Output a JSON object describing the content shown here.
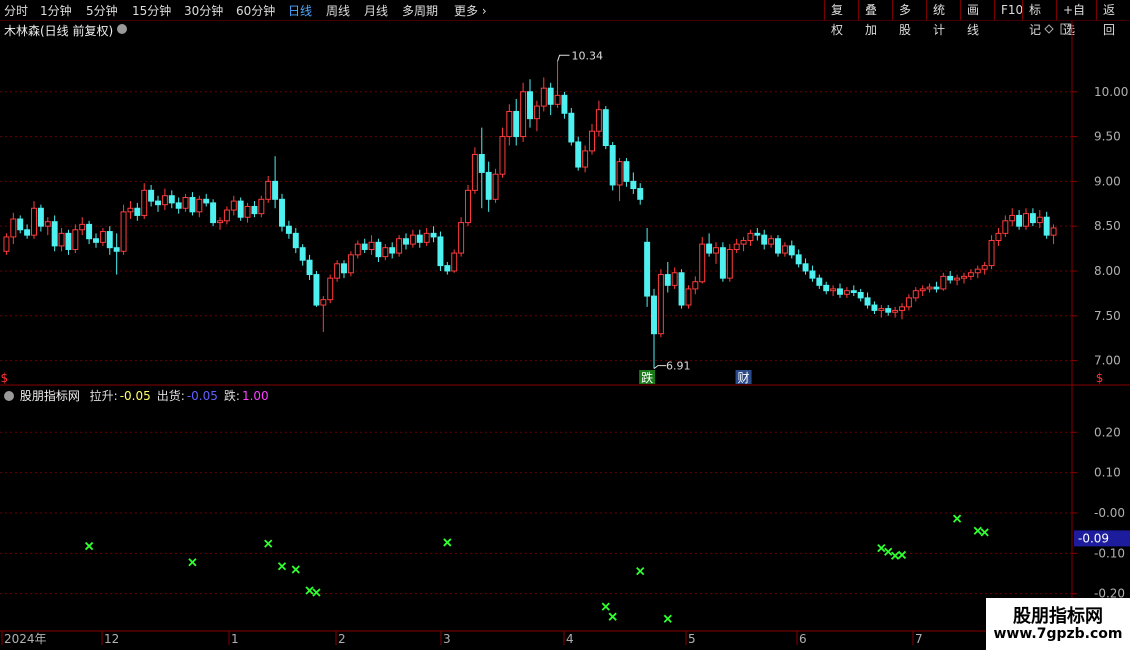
{
  "toolbar": {
    "periods": [
      "分时",
      "1分钟",
      "5分钟",
      "15分钟",
      "30分钟",
      "60分钟",
      "日线",
      "周线",
      "月线",
      "多周期",
      "更多"
    ],
    "active_period": "日线",
    "actions": [
      "复权",
      "叠加",
      "多股",
      "统计",
      "画线",
      "F10",
      "标记",
      "+自选",
      "返回"
    ]
  },
  "main_panel": {
    "title": "木林森(日线 前复权)",
    "high_label": "10.34",
    "low_label": "6.91",
    "y_ticks": [
      "10.00",
      "9.50",
      "9.00",
      "8.50",
      "8.00",
      "7.50",
      "7.00"
    ],
    "y_tick_values": [
      10.0,
      9.5,
      9.0,
      8.5,
      8.0,
      7.5,
      7.0
    ],
    "markers": [
      {
        "text": "$",
        "bar": 0,
        "color": "#ff3030"
      },
      {
        "text": "跌",
        "bar": 93,
        "color": "#ffffff",
        "bg": "#1a7a1a"
      },
      {
        "text": "财",
        "bar": 107,
        "color": "#ffffff",
        "bg": "#2a4a8a"
      },
      {
        "text": "$",
        "bar": 159,
        "color": "#ff3030"
      }
    ]
  },
  "sub_panel": {
    "title": "股朋指标网",
    "lines": [
      {
        "label": "拉升:",
        "value": "-0.05",
        "color": "#ffff66"
      },
      {
        "label": "出货:",
        "value": "-0.05",
        "color": "#6060ff"
      },
      {
        "label": "跌:",
        "value": "1.00",
        "color": "#ff40ff"
      }
    ],
    "y_ticks": [
      "0.20",
      "0.10",
      "-0.00",
      "-0.10",
      "-0.20"
    ],
    "y_tick_values": [
      0.2,
      0.1,
      0.0,
      -0.1,
      -0.2
    ],
    "current_value": "-0.09"
  },
  "x_axis": {
    "labels": [
      {
        "text": "2024年",
        "x": 2
      },
      {
        "text": "12",
        "x": 102
      },
      {
        "text": "1",
        "x": 229
      },
      {
        "text": "2",
        "x": 336
      },
      {
        "text": "3",
        "x": 441
      },
      {
        "text": "4",
        "x": 564
      },
      {
        "text": "5",
        "x": 686
      },
      {
        "text": "6",
        "x": 797
      },
      {
        "text": "7",
        "x": 913
      }
    ]
  },
  "watermark": {
    "line1": "股朋指标网",
    "line2": "www.7gpzb.com"
  },
  "colors": {
    "up": "#ff3c3c",
    "down": "#4ef0f0",
    "grid": "#6a0000",
    "cross": "#30ff30",
    "axis": "#b0b0b0"
  },
  "chart_data": {
    "type": "candlestick",
    "ylim_main": [
      6.75,
      10.6
    ],
    "ylim_sub": [
      -0.29,
      0.28
    ],
    "ohlc": [
      [
        8.22,
        8.42,
        8.18,
        8.38
      ],
      [
        8.38,
        8.65,
        8.3,
        8.58
      ],
      [
        8.58,
        8.62,
        8.42,
        8.46
      ],
      [
        8.46,
        8.52,
        8.36,
        8.4
      ],
      [
        8.4,
        8.78,
        8.36,
        8.7
      ],
      [
        8.7,
        8.74,
        8.44,
        8.5
      ],
      [
        8.5,
        8.6,
        8.4,
        8.55
      ],
      [
        8.55,
        8.62,
        8.22,
        8.28
      ],
      [
        8.28,
        8.48,
        8.22,
        8.42
      ],
      [
        8.42,
        8.46,
        8.18,
        8.24
      ],
      [
        8.24,
        8.52,
        8.2,
        8.46
      ],
      [
        8.46,
        8.6,
        8.4,
        8.52
      ],
      [
        8.52,
        8.56,
        8.3,
        8.36
      ],
      [
        8.36,
        8.42,
        8.26,
        8.32
      ],
      [
        8.32,
        8.48,
        8.28,
        8.44
      ],
      [
        8.44,
        8.5,
        8.18,
        8.26
      ],
      [
        8.26,
        8.42,
        7.96,
        8.22
      ],
      [
        8.22,
        8.74,
        8.18,
        8.66
      ],
      [
        8.66,
        8.78,
        8.58,
        8.7
      ],
      [
        8.7,
        8.76,
        8.56,
        8.62
      ],
      [
        8.62,
        8.98,
        8.58,
        8.9
      ],
      [
        8.9,
        8.96,
        8.72,
        8.78
      ],
      [
        8.78,
        8.84,
        8.66,
        8.74
      ],
      [
        8.74,
        8.92,
        8.68,
        8.84
      ],
      [
        8.84,
        8.9,
        8.7,
        8.76
      ],
      [
        8.76,
        8.82,
        8.64,
        8.7
      ],
      [
        8.7,
        8.86,
        8.66,
        8.82
      ],
      [
        8.82,
        8.88,
        8.62,
        8.66
      ],
      [
        8.66,
        8.84,
        8.6,
        8.8
      ],
      [
        8.8,
        8.86,
        8.72,
        8.76
      ],
      [
        8.76,
        8.8,
        8.5,
        8.54
      ],
      [
        8.54,
        8.6,
        8.46,
        8.56
      ],
      [
        8.56,
        8.72,
        8.52,
        8.68
      ],
      [
        8.68,
        8.84,
        8.62,
        8.78
      ],
      [
        8.78,
        8.82,
        8.56,
        8.6
      ],
      [
        8.6,
        8.76,
        8.54,
        8.72
      ],
      [
        8.72,
        8.78,
        8.6,
        8.64
      ],
      [
        8.64,
        8.84,
        8.6,
        8.8
      ],
      [
        8.8,
        9.06,
        8.76,
        9.0
      ],
      [
        9.0,
        9.28,
        8.7,
        8.8
      ],
      [
        8.8,
        8.86,
        8.44,
        8.5
      ],
      [
        8.5,
        8.56,
        8.36,
        8.42
      ],
      [
        8.42,
        8.48,
        8.2,
        8.26
      ],
      [
        8.26,
        8.3,
        8.06,
        8.12
      ],
      [
        8.12,
        8.18,
        7.9,
        7.96
      ],
      [
        7.96,
        8.0,
        7.6,
        7.62
      ],
      [
        7.62,
        7.72,
        7.32,
        7.68
      ],
      [
        7.68,
        7.96,
        7.64,
        7.92
      ],
      [
        7.92,
        8.12,
        7.88,
        8.08
      ],
      [
        8.08,
        8.12,
        7.92,
        7.98
      ],
      [
        7.98,
        8.22,
        7.94,
        8.18
      ],
      [
        8.18,
        8.34,
        8.14,
        8.3
      ],
      [
        8.3,
        8.36,
        8.2,
        8.24
      ],
      [
        8.24,
        8.4,
        8.18,
        8.32
      ],
      [
        8.32,
        8.36,
        8.1,
        8.16
      ],
      [
        8.16,
        8.3,
        8.12,
        8.26
      ],
      [
        8.26,
        8.32,
        8.14,
        8.2
      ],
      [
        8.2,
        8.4,
        8.16,
        8.36
      ],
      [
        8.36,
        8.42,
        8.24,
        8.3
      ],
      [
        8.3,
        8.46,
        8.26,
        8.4
      ],
      [
        8.4,
        8.46,
        8.26,
        8.32
      ],
      [
        8.32,
        8.48,
        8.28,
        8.42
      ],
      [
        8.42,
        8.5,
        8.32,
        8.38
      ],
      [
        8.38,
        8.44,
        8.0,
        8.06
      ],
      [
        8.06,
        8.1,
        7.96,
        8.0
      ],
      [
        8.0,
        8.24,
        7.98,
        8.2
      ],
      [
        8.2,
        8.6,
        8.16,
        8.54
      ],
      [
        8.54,
        8.96,
        8.5,
        8.9
      ],
      [
        8.9,
        9.38,
        8.86,
        9.3
      ],
      [
        9.3,
        9.6,
        8.7,
        9.1
      ],
      [
        9.1,
        9.22,
        8.66,
        8.8
      ],
      [
        8.8,
        9.14,
        8.76,
        9.08
      ],
      [
        9.08,
        9.6,
        9.04,
        9.5
      ],
      [
        9.5,
        9.86,
        9.4,
        9.78
      ],
      [
        9.78,
        9.92,
        9.4,
        9.5
      ],
      [
        9.5,
        10.1,
        9.44,
        10.0
      ],
      [
        10.0,
        10.14,
        9.6,
        9.7
      ],
      [
        9.7,
        9.9,
        9.56,
        9.84
      ],
      [
        9.84,
        10.16,
        9.78,
        10.04
      ],
      [
        10.04,
        10.1,
        9.74,
        9.86
      ],
      [
        9.86,
        10.34,
        9.82,
        9.96
      ],
      [
        9.96,
        10.0,
        9.7,
        9.76
      ],
      [
        9.76,
        9.82,
        9.4,
        9.44
      ],
      [
        9.44,
        9.5,
        9.12,
        9.16
      ],
      [
        9.16,
        9.4,
        9.1,
        9.34
      ],
      [
        9.34,
        9.64,
        9.3,
        9.56
      ],
      [
        9.56,
        9.9,
        9.5,
        9.8
      ],
      [
        9.8,
        9.84,
        9.36,
        9.4
      ],
      [
        9.4,
        9.44,
        8.9,
        8.96
      ],
      [
        8.96,
        9.26,
        8.78,
        9.22
      ],
      [
        9.22,
        9.26,
        8.94,
        9.0
      ],
      [
        9.0,
        9.1,
        8.86,
        8.92
      ],
      [
        8.92,
        8.98,
        8.74,
        8.8
      ],
      [
        8.32,
        8.48,
        7.6,
        7.72
      ],
      [
        7.72,
        7.8,
        6.91,
        7.3
      ],
      [
        7.3,
        8.02,
        7.26,
        7.96
      ],
      [
        7.96,
        8.1,
        7.76,
        7.84
      ],
      [
        7.84,
        8.04,
        7.8,
        7.98
      ],
      [
        7.98,
        8.02,
        7.58,
        7.62
      ],
      [
        7.62,
        7.84,
        7.58,
        7.8
      ],
      [
        7.8,
        7.94,
        7.74,
        7.88
      ],
      [
        7.88,
        8.38,
        7.86,
        8.3
      ],
      [
        8.3,
        8.42,
        8.16,
        8.2
      ],
      [
        8.2,
        8.32,
        8.08,
        8.26
      ],
      [
        8.26,
        8.32,
        7.88,
        7.92
      ],
      [
        7.92,
        8.3,
        7.88,
        8.24
      ],
      [
        8.24,
        8.36,
        8.2,
        8.3
      ],
      [
        8.3,
        8.38,
        8.22,
        8.34
      ],
      [
        8.34,
        8.46,
        8.28,
        8.42
      ],
      [
        8.42,
        8.48,
        8.34,
        8.4
      ],
      [
        8.4,
        8.46,
        8.24,
        8.3
      ],
      [
        8.3,
        8.4,
        8.26,
        8.36
      ],
      [
        8.36,
        8.4,
        8.16,
        8.2
      ],
      [
        8.2,
        8.32,
        8.16,
        8.28
      ],
      [
        8.28,
        8.34,
        8.14,
        8.18
      ],
      [
        8.18,
        8.24,
        8.04,
        8.08
      ],
      [
        8.08,
        8.14,
        7.96,
        8.0
      ],
      [
        8.0,
        8.06,
        7.88,
        7.92
      ],
      [
        7.92,
        7.96,
        7.8,
        7.84
      ],
      [
        7.84,
        7.88,
        7.74,
        7.78
      ],
      [
        7.78,
        7.84,
        7.72,
        7.8
      ],
      [
        7.8,
        7.86,
        7.7,
        7.74
      ],
      [
        7.74,
        7.82,
        7.7,
        7.78
      ],
      [
        7.78,
        7.84,
        7.72,
        7.76
      ],
      [
        7.76,
        7.8,
        7.66,
        7.7
      ],
      [
        7.7,
        7.76,
        7.58,
        7.62
      ],
      [
        7.62,
        7.66,
        7.52,
        7.56
      ],
      [
        7.56,
        7.62,
        7.48,
        7.58
      ],
      [
        7.58,
        7.62,
        7.5,
        7.54
      ],
      [
        7.54,
        7.6,
        7.48,
        7.56
      ],
      [
        7.56,
        7.64,
        7.46,
        7.6
      ],
      [
        7.6,
        7.74,
        7.56,
        7.7
      ],
      [
        7.7,
        7.82,
        7.66,
        7.78
      ],
      [
        7.78,
        7.84,
        7.72,
        7.8
      ],
      [
        7.8,
        7.86,
        7.76,
        7.82
      ],
      [
        7.82,
        7.88,
        7.76,
        7.8
      ],
      [
        7.8,
        7.98,
        7.78,
        7.94
      ],
      [
        7.94,
        8.0,
        7.86,
        7.9
      ],
      [
        7.9,
        7.96,
        7.84,
        7.92
      ],
      [
        7.92,
        7.98,
        7.86,
        7.94
      ],
      [
        7.94,
        8.02,
        7.9,
        7.98
      ],
      [
        7.98,
        8.06,
        7.92,
        8.02
      ],
      [
        8.02,
        8.1,
        7.96,
        8.06
      ],
      [
        8.06,
        8.4,
        8.02,
        8.34
      ],
      [
        8.34,
        8.48,
        8.28,
        8.42
      ],
      [
        8.42,
        8.62,
        8.38,
        8.56
      ],
      [
        8.56,
        8.7,
        8.5,
        8.62
      ],
      [
        8.62,
        8.68,
        8.46,
        8.5
      ],
      [
        8.5,
        8.7,
        8.46,
        8.64
      ],
      [
        8.64,
        8.7,
        8.5,
        8.54
      ],
      [
        8.54,
        8.68,
        8.48,
        8.6
      ],
      [
        8.6,
        8.66,
        8.36,
        8.4
      ],
      [
        8.4,
        8.52,
        8.3,
        8.48
      ]
    ],
    "signals": [
      {
        "bar": 12,
        "value": -0.082
      },
      {
        "bar": 27,
        "value": -0.122
      },
      {
        "bar": 38,
        "value": -0.076
      },
      {
        "bar": 40,
        "value": -0.132
      },
      {
        "bar": 42,
        "value": -0.14
      },
      {
        "bar": 44,
        "value": -0.192
      },
      {
        "bar": 45,
        "value": -0.197
      },
      {
        "bar": 64,
        "value": -0.073
      },
      {
        "bar": 87,
        "value": -0.232
      },
      {
        "bar": 88,
        "value": -0.257
      },
      {
        "bar": 92,
        "value": -0.144
      },
      {
        "bar": 96,
        "value": -0.262
      },
      {
        "bar": 127,
        "value": -0.087
      },
      {
        "bar": 128,
        "value": -0.096
      },
      {
        "bar": 129,
        "value": -0.106
      },
      {
        "bar": 130,
        "value": -0.104
      },
      {
        "bar": 138,
        "value": -0.014
      },
      {
        "bar": 141,
        "value": -0.044
      },
      {
        "bar": 142,
        "value": -0.048
      }
    ]
  }
}
